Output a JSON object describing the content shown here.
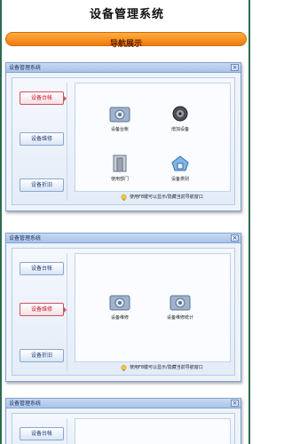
{
  "app": {
    "title": "设备管理系统",
    "nav_label": "导航展示"
  },
  "windows": [
    {
      "title": "设备管理系统",
      "close_glyph": "×",
      "sidebar": [
        {
          "label": "设备台帐",
          "active": true
        },
        {
          "label": "设备维修",
          "active": false
        },
        {
          "label": "设备折旧",
          "active": false
        }
      ],
      "items": [
        {
          "label": "设备台帐",
          "icon": "gear-box-icon"
        },
        {
          "label": "增加设备",
          "icon": "gear-icon"
        },
        {
          "label": "使用部门",
          "icon": "door-icon"
        },
        {
          "label": "设备类别",
          "icon": "category-icon"
        }
      ],
      "hint": "使用F8键可以显示/隐藏当前导航窗口"
    },
    {
      "title": "设备管理系统",
      "close_glyph": "×",
      "sidebar": [
        {
          "label": "设备台帐",
          "active": false
        },
        {
          "label": "设备维修",
          "active": true
        },
        {
          "label": "设备折旧",
          "active": false
        }
      ],
      "items": [
        {
          "label": "设备维修",
          "icon": "gear-box-icon"
        },
        {
          "label": "设备维修统计",
          "icon": "gear-box-icon"
        }
      ],
      "hint": "使用F8键可以显示/隐藏当前导航窗口"
    },
    {
      "title": "设备管理系统",
      "close_glyph": "×",
      "sidebar": [
        {
          "label": "设备台帐",
          "active": false
        }
      ]
    }
  ]
}
